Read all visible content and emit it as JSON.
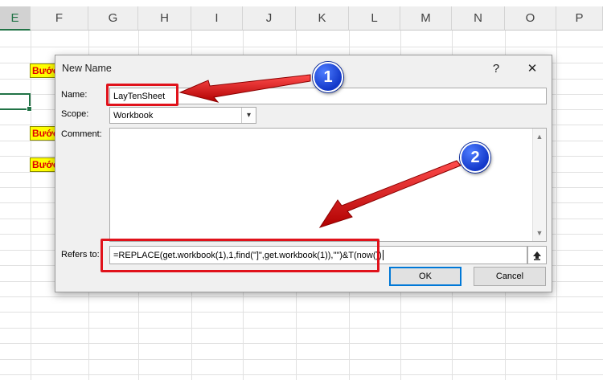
{
  "columns": [
    "E",
    "F",
    "G",
    "H",
    "I",
    "J",
    "K",
    "L",
    "M",
    "N",
    "O",
    "P"
  ],
  "step_label": "Bước",
  "dialog": {
    "title": "New Name",
    "help_glyph": "?",
    "close_glyph": "✕",
    "name_label": "Name:",
    "name_value": "LayTenSheet",
    "scope_label": "Scope:",
    "scope_value": "Workbook",
    "comment_label": "Comment:",
    "comment_value": "",
    "refers_label": "Refers to:",
    "refers_value": "=REPLACE(get.workbook(1),1,find(\"]\",get.workbook(1)),\"\")&T(now())",
    "ok_label": "OK",
    "cancel_label": "Cancel"
  },
  "annotations": {
    "badge1": "1",
    "badge2": "2",
    "accent_red": "#e0121b",
    "badge_blue": "#1238c9"
  }
}
